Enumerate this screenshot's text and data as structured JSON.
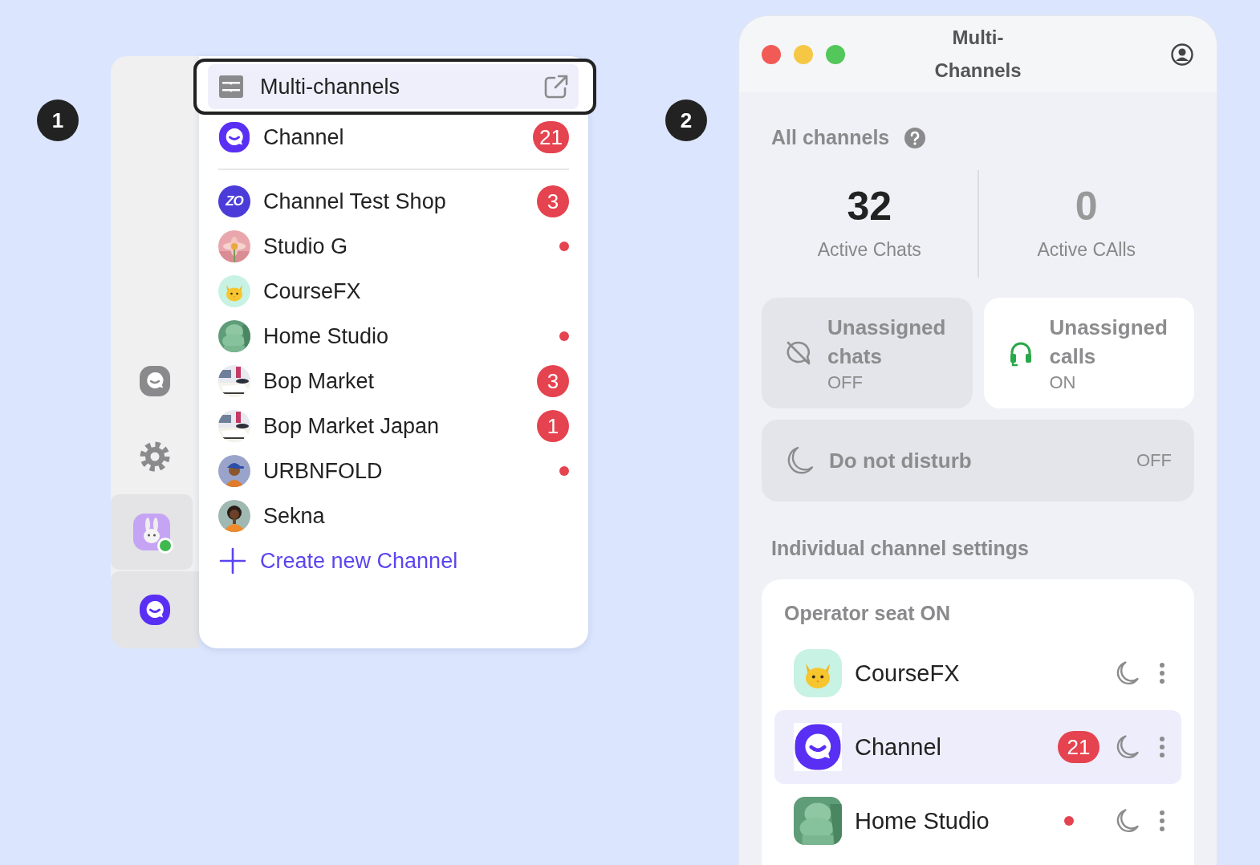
{
  "steps": [
    "1",
    "2"
  ],
  "rail": {
    "items": [
      {
        "kind": "chat"
      },
      {
        "kind": "gear"
      },
      {
        "kind": "avatar",
        "online": true
      },
      {
        "kind": "logo"
      }
    ]
  },
  "menu": {
    "header": {
      "label": "Multi-channels",
      "focused": true
    },
    "pinned": [
      {
        "name": "Channel",
        "avatar": {
          "kind": "logo"
        },
        "unread": "21",
        "dot": false
      }
    ],
    "items": [
      {
        "name": "Channel Test Shop",
        "avatar": {
          "kind": "zo",
          "text": "ZO"
        },
        "unread": "3",
        "dot": false
      },
      {
        "name": "Studio G",
        "dot": true
      },
      {
        "name": "CourseFX",
        "avatar": {
          "kind": "cat"
        },
        "dot": false
      },
      {
        "name": "Home Studio",
        "dot": true
      },
      {
        "name": "Bop Market",
        "unread": "3",
        "dot": false
      },
      {
        "name": "Bop Market Japan",
        "unread": "1",
        "dot": false
      },
      {
        "name": "URBNFOLD",
        "dot": true
      },
      {
        "name": "Sekna",
        "dot": false
      }
    ],
    "create": {
      "label": "Create new Channel"
    }
  },
  "window": {
    "title": "Multi-Channels",
    "all_channels": "All channels",
    "stats": [
      {
        "value": "32",
        "label": "Active Chats",
        "emphasized": true
      },
      {
        "value": "0",
        "label": "Active CAlls",
        "emphasized": false
      }
    ],
    "toggles": [
      {
        "kind": "chats",
        "title": "Unassigned chats",
        "status": "OFF",
        "on": false
      },
      {
        "kind": "calls",
        "title": "Unassigned calls",
        "status": "ON",
        "on": true
      }
    ],
    "dnd": {
      "title": "Do not disturb",
      "status": "OFF",
      "on": false
    },
    "settings_title": "Individual channel settings",
    "group": {
      "title": "Operator seat ON",
      "channels": [
        {
          "name": "CourseFX",
          "avatar": {
            "kind": "cat"
          },
          "dot": false,
          "selected": false
        },
        {
          "name": "Channel",
          "avatar": {
            "kind": "logo"
          },
          "unread": "21",
          "dot": false,
          "selected": true
        },
        {
          "name": "Home Studio",
          "dot": true,
          "selected": false
        }
      ]
    }
  }
}
